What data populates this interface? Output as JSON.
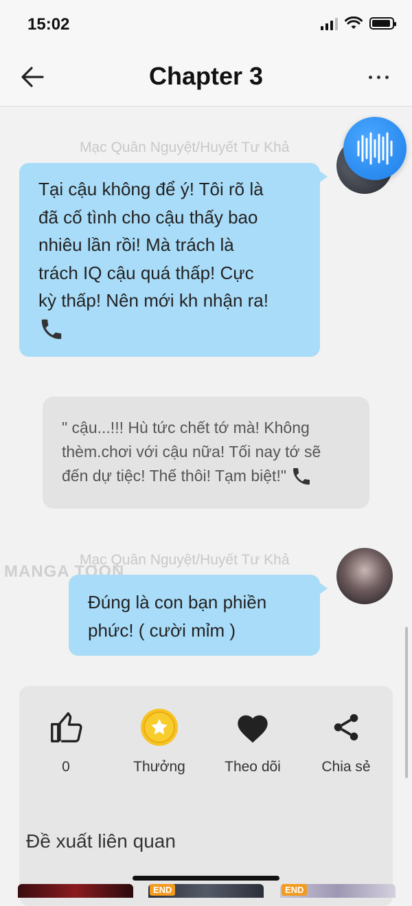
{
  "status_bar": {
    "time": "15:02"
  },
  "header": {
    "title": "Chapter 3"
  },
  "messages": [
    {
      "author": "Mạc Quân Nguyệt/Huyết Tư Khả",
      "lines": [
        "Tại cậu không để ý! Tôi rõ là",
        "đã cố tình cho cậu thấy bao",
        "nhiêu lần rồi! Mà trách là",
        "trách IQ cậu quá thấp! Cực",
        "kỳ thấp! Nên mới kh nhận ra!"
      ],
      "icon": "phone-icon"
    },
    {
      "lines": [
        "\" cậu...!!! Hù tức chết tớ mà! Không",
        "thèm.chơi với cậu nữa! Tối nay tớ sẽ",
        "đến dự tiệc! Thế thôi! Tạm biệt!\""
      ],
      "icon": "phone-icon"
    },
    {
      "author": "Mạc Quân Nguyệt/Huyết Tư Khả",
      "lines": [
        "Đúng là con bạn phiền",
        "phức! ( cười mỉm )"
      ]
    }
  ],
  "watermark": "MANGA TOON",
  "actions": [
    {
      "label": "0",
      "icon": "thumbs-up-icon"
    },
    {
      "label": "Thưởng",
      "icon": "star-coin-icon"
    },
    {
      "label": "Theo dõi",
      "icon": "heart-icon"
    },
    {
      "label": "Chia sẻ",
      "icon": "share-icon"
    }
  ],
  "related": {
    "title": "Đề xuất liên quan",
    "badges": [
      "END",
      "END"
    ]
  },
  "colors": {
    "bubble_blue": "#a9dcf8",
    "bubble_gray": "#e3e3e3",
    "accent_blue": "#1d7ee8",
    "coin_yellow": "#f7c325"
  }
}
